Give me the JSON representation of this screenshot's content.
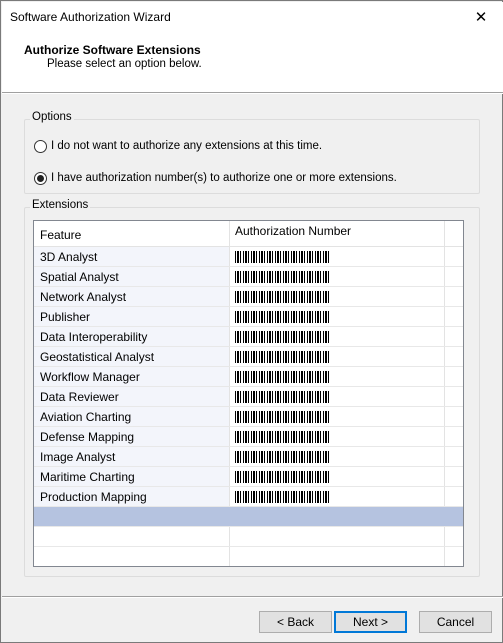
{
  "window": {
    "title": "Software Authorization Wizard",
    "close_glyph": "✕"
  },
  "header": {
    "title": "Authorize Software Extensions",
    "subtitle": "Please select an option below."
  },
  "options": {
    "label": "Options",
    "radios": [
      {
        "label": "I do not want to authorize any extensions at this time.",
        "checked": false
      },
      {
        "label": "I have authorization number(s) to authorize one or more extensions.",
        "checked": true
      }
    ]
  },
  "extensions": {
    "label": "Extensions",
    "columns": [
      "Feature",
      "Authorization Number"
    ],
    "rows": [
      {
        "feature": "3D Analyst"
      },
      {
        "feature": "Spatial Analyst"
      },
      {
        "feature": "Network Analyst"
      },
      {
        "feature": "Publisher"
      },
      {
        "feature": "Data Interoperability"
      },
      {
        "feature": "Geostatistical Analyst"
      },
      {
        "feature": "Workflow Manager"
      },
      {
        "feature": "Data Reviewer"
      },
      {
        "feature": "Aviation Charting"
      },
      {
        "feature": "Defense Mapping"
      },
      {
        "feature": "Image Analyst"
      },
      {
        "feature": "Maritime Charting"
      },
      {
        "feature": "Production Mapping"
      }
    ],
    "selected_row_color": "#b5c3e0"
  },
  "buttons": {
    "back": "< Back",
    "next": "Next >",
    "cancel": "Cancel"
  }
}
